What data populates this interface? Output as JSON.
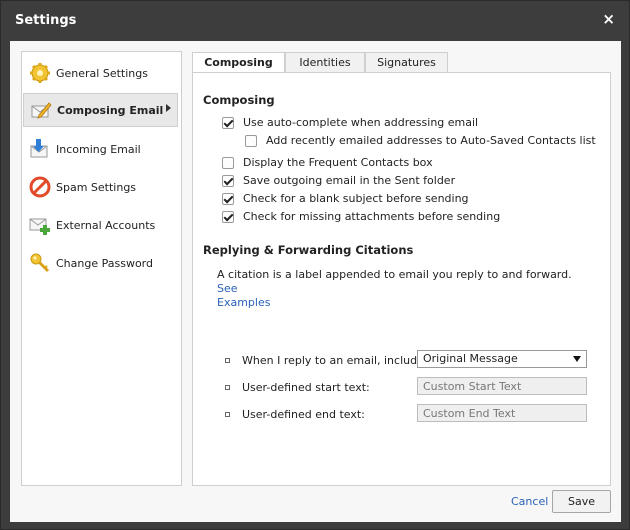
{
  "window": {
    "title": "Settings",
    "close_glyph": "×"
  },
  "sidebar": {
    "items": [
      {
        "label": "General Settings",
        "icon": "gear-icon",
        "active": false
      },
      {
        "label": "Composing Email",
        "icon": "pencil-icon",
        "active": true
      },
      {
        "label": "Incoming Email",
        "icon": "download-icon",
        "active": false
      },
      {
        "label": "Spam Settings",
        "icon": "no-entry-icon",
        "active": false
      },
      {
        "label": "External Accounts",
        "icon": "envelope-plus-icon",
        "active": false
      },
      {
        "label": "Change Password",
        "icon": "key-icon",
        "active": false
      }
    ]
  },
  "tabs": [
    {
      "label": "Composing",
      "active": true
    },
    {
      "label": "Identities",
      "active": false
    },
    {
      "label": "Signatures",
      "active": false
    }
  ],
  "composing": {
    "section_title": "Composing",
    "options": [
      {
        "label": "Use auto-complete when addressing email",
        "checked": true
      },
      {
        "label": "Add recently emailed addresses to Auto-Saved Contacts list",
        "checked": false
      },
      {
        "label": "Display the Frequent Contacts box",
        "checked": false
      },
      {
        "label": "Save outgoing email in the Sent folder",
        "checked": true
      },
      {
        "label": "Check for a blank subject before sending",
        "checked": true
      },
      {
        "label": "Check for missing attachments before sending",
        "checked": true
      }
    ]
  },
  "citations": {
    "section_title": "Replying & Forwarding Citations",
    "note": "A citation is a label appended to email you reply to and forward.",
    "see_link": "See",
    "examples_link": "Examples",
    "include_label": "When I reply to an email, include:",
    "include_value": "Original Message",
    "start_label": "User-defined start text:",
    "start_placeholder": "Custom Start Text",
    "end_label": "User-defined end text:",
    "end_placeholder": "Custom End Text"
  },
  "footer": {
    "cancel_label": "Cancel",
    "save_label": "Save"
  }
}
